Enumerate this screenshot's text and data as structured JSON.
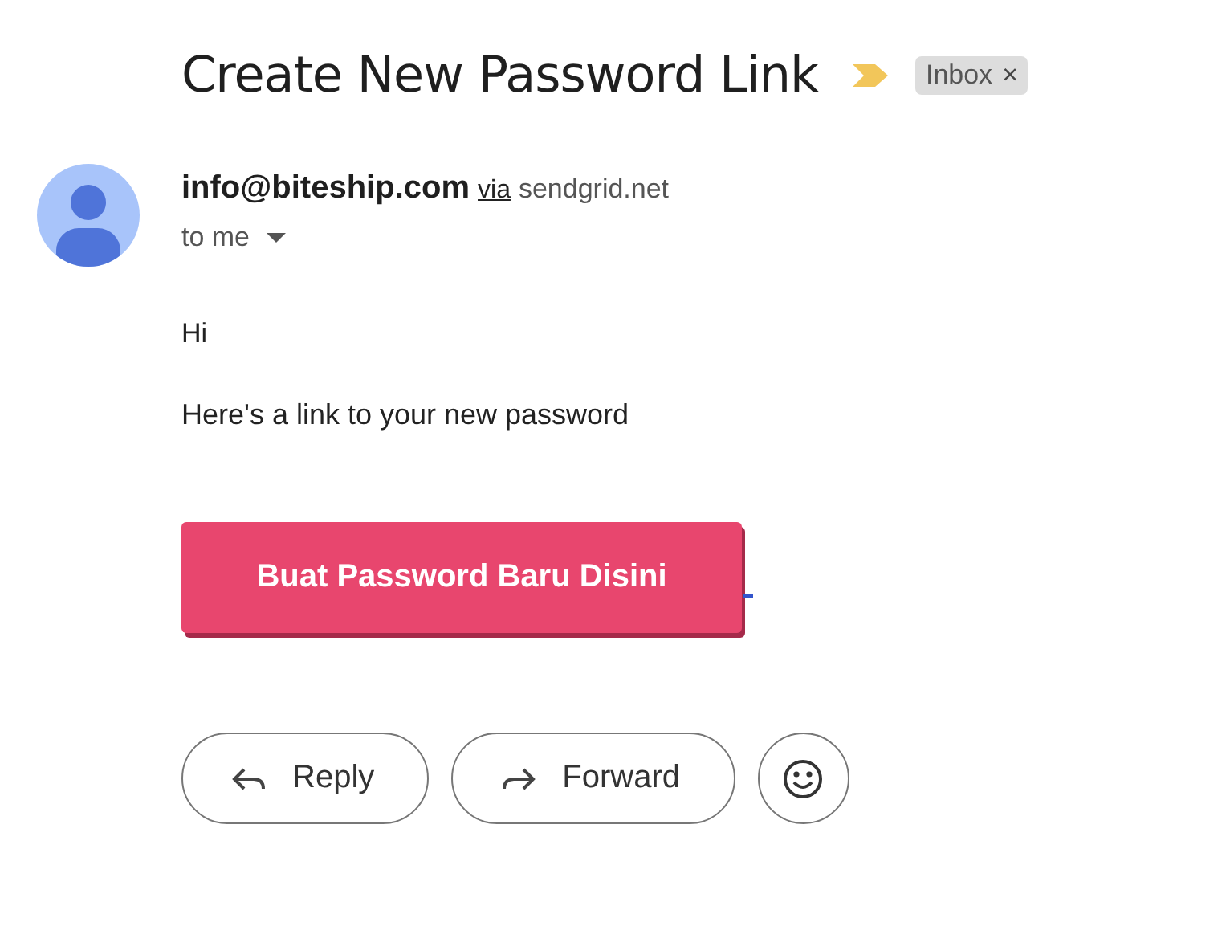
{
  "subject": "Create New Password Link",
  "important": true,
  "label": {
    "text": "Inbox",
    "close": "×"
  },
  "sender": {
    "email": "info@biteship.com",
    "via": "via",
    "domain": "sendgrid.net",
    "recipient": "to me"
  },
  "body": {
    "greeting": "Hi",
    "line": "Here's a link to your new password",
    "cta": "Buat Password Baru Disini"
  },
  "actions": [
    {
      "kind": "reply",
      "label": "Reply"
    },
    {
      "kind": "forward",
      "label": "Forward"
    },
    {
      "kind": "emoji"
    }
  ]
}
